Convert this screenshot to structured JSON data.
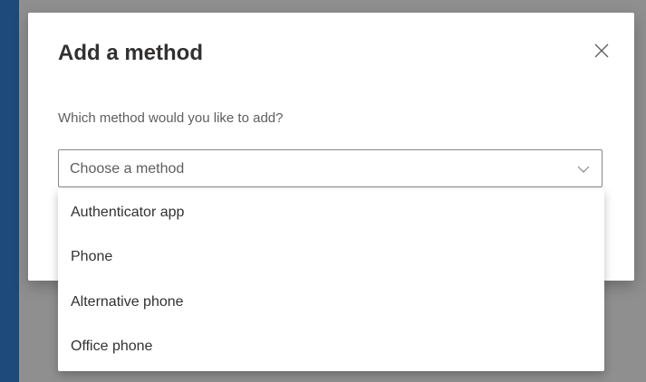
{
  "dialog": {
    "title": "Add a method",
    "close_icon": "close-icon",
    "prompt": "Which method would you like to add?",
    "select": {
      "placeholder": "Choose a method",
      "chevron_icon": "chevron-down-icon",
      "expanded": true,
      "options": [
        {
          "label": "Authenticator app"
        },
        {
          "label": "Phone"
        },
        {
          "label": "Alternative phone"
        },
        {
          "label": "Office phone"
        }
      ]
    }
  },
  "colors": {
    "page_background": "#1d4a7a",
    "overlay": "#8f8f8f",
    "dialog_background": "#ffffff",
    "title_text": "#323130",
    "secondary_text": "#605e5c",
    "border": "#8a8886"
  }
}
